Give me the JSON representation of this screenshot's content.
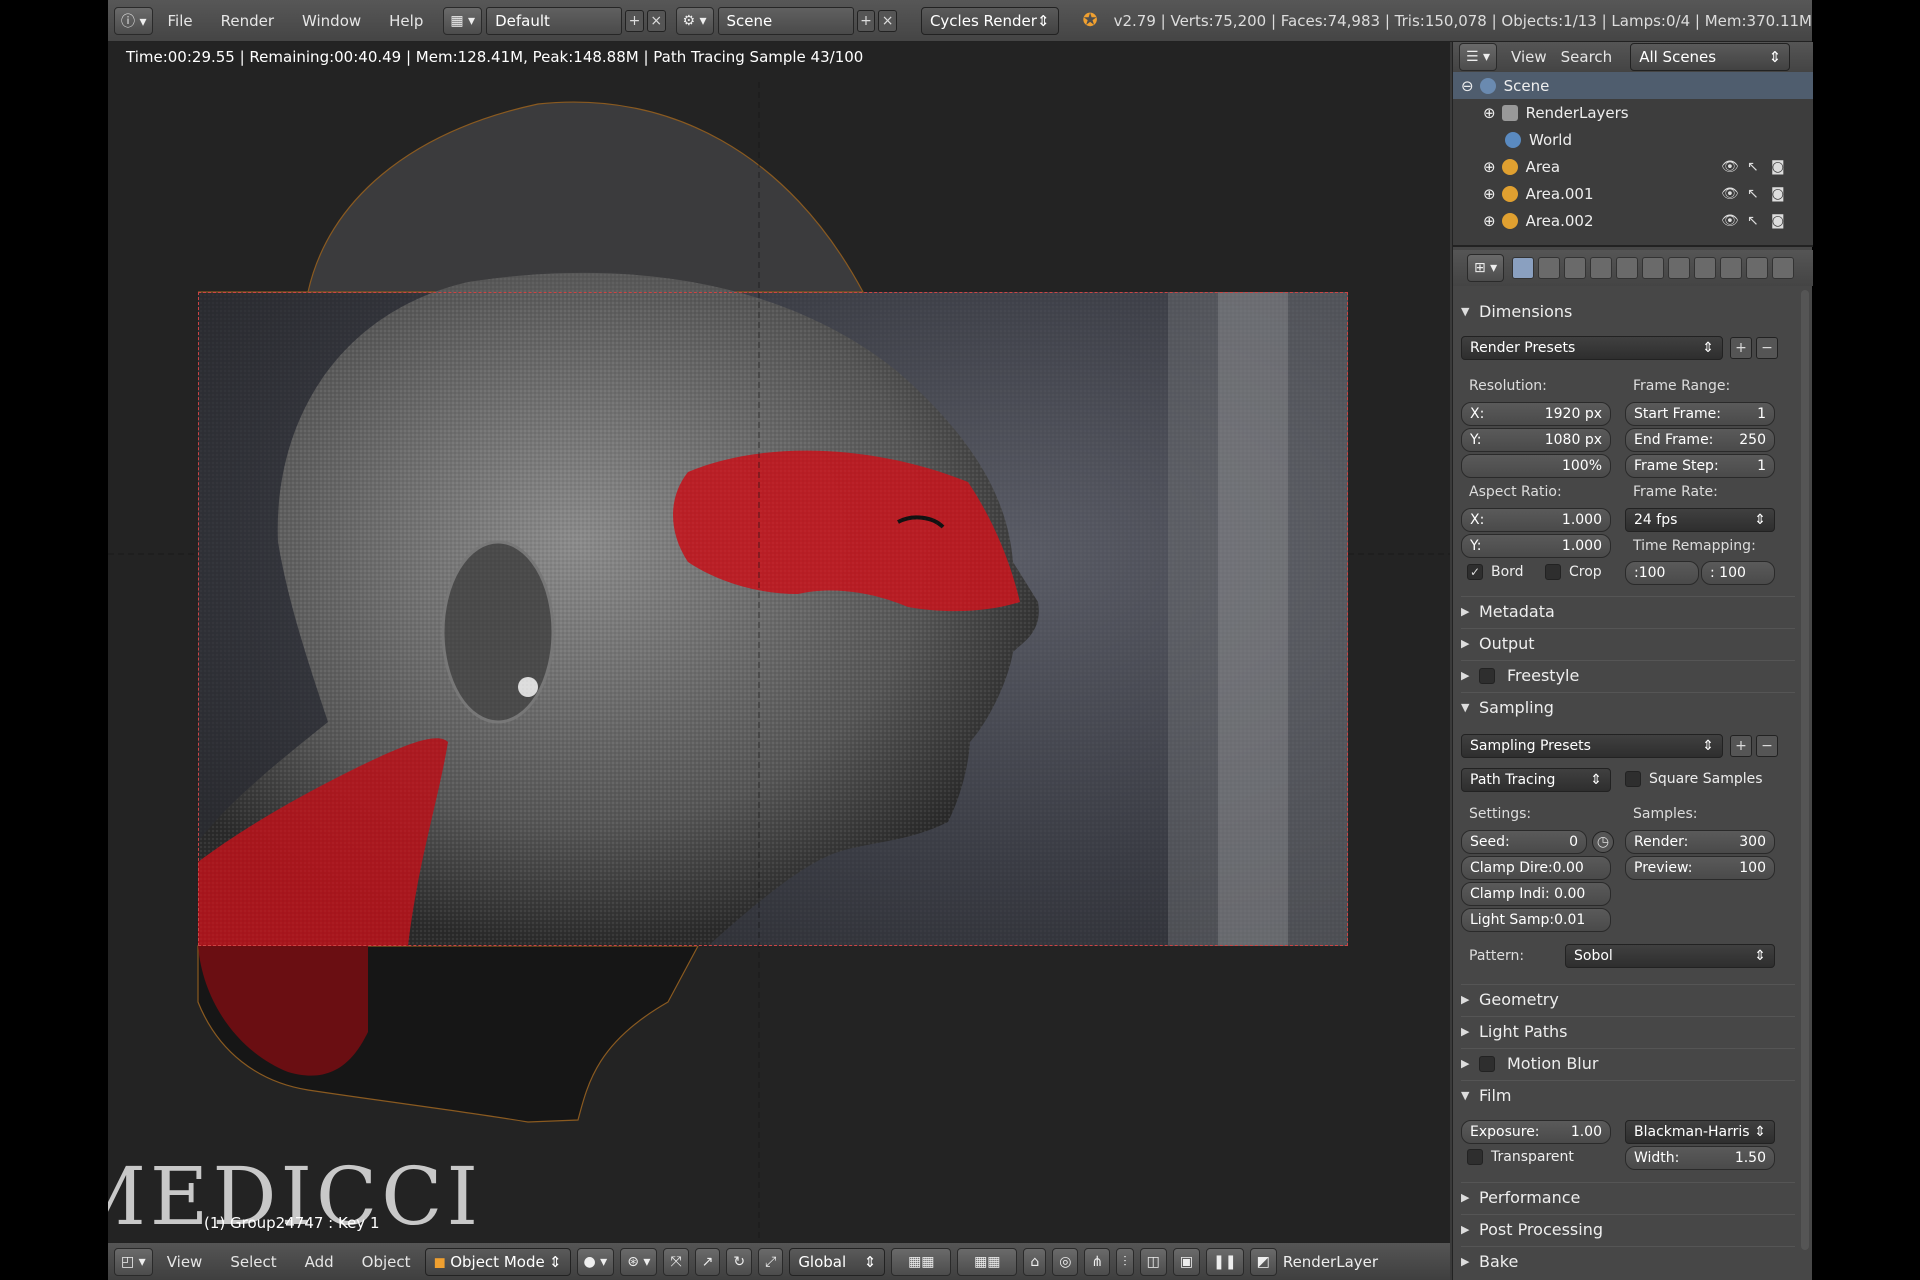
{
  "topbar": {
    "menus": [
      "File",
      "Render",
      "Window",
      "Help"
    ],
    "layout": "Default",
    "scene": "Scene",
    "engine": "Cycles Render",
    "stats": "v2.79 | Verts:75,200 | Faces:74,983 | Tris:150,078 | Objects:1/13 | Lamps:0/4 | Mem:370.11M"
  },
  "viewport": {
    "render_status": "Time:00:29.55 | Remaining:00:40.49 | Mem:128.41M, Peak:148.88M | Path Tracing Sample 43/100",
    "object_info": "(1) Group24747 : Key 1",
    "watermark": "MEDICCI"
  },
  "bottombar": {
    "menus": [
      "View",
      "Select",
      "Add",
      "Object"
    ],
    "mode": "Object Mode",
    "orientation": "Global",
    "renderlayer": "RenderLayer"
  },
  "outliner": {
    "header": {
      "view": "View",
      "search": "Search",
      "scenes": "All Scenes"
    },
    "items": [
      {
        "label": "Scene"
      },
      {
        "label": "RenderLayers"
      },
      {
        "label": "World"
      },
      {
        "label": "Area"
      },
      {
        "label": "Area.001"
      },
      {
        "label": "Area.002"
      }
    ]
  },
  "properties": {
    "dimensions": {
      "title": "Dimensions",
      "presets": "Render Presets",
      "resolution_label": "Resolution:",
      "res_x": {
        "label": "X:",
        "value": "1920 px"
      },
      "res_y": {
        "label": "Y:",
        "value": "1080 px"
      },
      "res_pct": "100%",
      "frame_range_label": "Frame Range:",
      "start": {
        "label": "Start Frame:",
        "value": "1"
      },
      "end": {
        "label": "End Frame:",
        "value": "250"
      },
      "step": {
        "label": "Frame Step:",
        "value": "1"
      },
      "aspect_label": "Aspect Ratio:",
      "asp_x": {
        "label": "X:",
        "value": "1.000"
      },
      "asp_y": {
        "label": "Y:",
        "value": "1.000"
      },
      "frame_rate_label": "Frame Rate:",
      "fps": "24 fps",
      "time_remap_label": "Time Remapping:",
      "remap_old": ":100",
      "remap_new": ": 100",
      "bord": "Bord",
      "crop": "Crop"
    },
    "collapsed1": [
      "Metadata",
      "Output",
      "Freestyle"
    ],
    "sampling": {
      "title": "Sampling",
      "presets": "Sampling Presets",
      "integrator": "Path Tracing",
      "square": "Square Samples",
      "settings_label": "Settings:",
      "samples_label": "Samples:",
      "seed": {
        "label": "Seed:",
        "value": "0"
      },
      "clamp_dir": "Clamp Dire:0.00",
      "clamp_ind": "Clamp Indi: 0.00",
      "light_samp": "Light Samp:0.01",
      "render": {
        "label": "Render:",
        "value": "300"
      },
      "preview": {
        "label": "Preview:",
        "value": "100"
      },
      "pattern_label": "Pattern:",
      "pattern": "Sobol"
    },
    "collapsed2": [
      "Geometry",
      "Light Paths",
      "Motion Blur"
    ],
    "film": {
      "title": "Film",
      "exposure": {
        "label": "Exposure:",
        "value": "1.00"
      },
      "filter": "Blackman-Harris",
      "transparent": "Transparent",
      "width": {
        "label": "Width:",
        "value": "1.50"
      }
    },
    "collapsed3": [
      "Performance",
      "Post Processing",
      "Bake"
    ]
  }
}
